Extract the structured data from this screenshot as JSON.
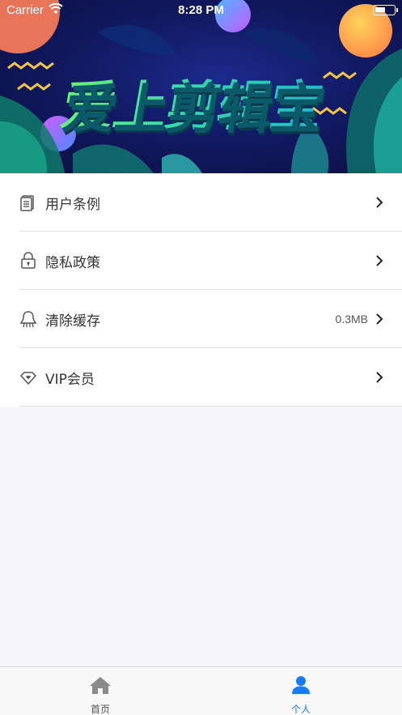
{
  "status_bar": {
    "carrier": "Carrier",
    "time": "8:28 PM",
    "icons": [
      "wifi-icon",
      "battery-icon"
    ]
  },
  "banner": {
    "title": "爱上剪辑宝"
  },
  "menu": {
    "items": [
      {
        "label": "用户条例",
        "value": "",
        "icon": "document-icon"
      },
      {
        "label": "隐私政策",
        "value": "",
        "icon": "lock-icon"
      },
      {
        "label": "清除缓存",
        "value": "0.3MB",
        "icon": "broom-icon"
      },
      {
        "label": "VIP会员",
        "value": "",
        "icon": "diamond-heart-icon"
      }
    ]
  },
  "tabbar": {
    "tabs": [
      {
        "label": "首页",
        "icon": "home-icon",
        "active": false
      },
      {
        "label": "个人",
        "icon": "person-icon",
        "active": true
      }
    ]
  },
  "colors": {
    "accent": "#1a7cf5",
    "inactive_tab": "#8a8a8a",
    "banner_bg": "#121a63"
  }
}
